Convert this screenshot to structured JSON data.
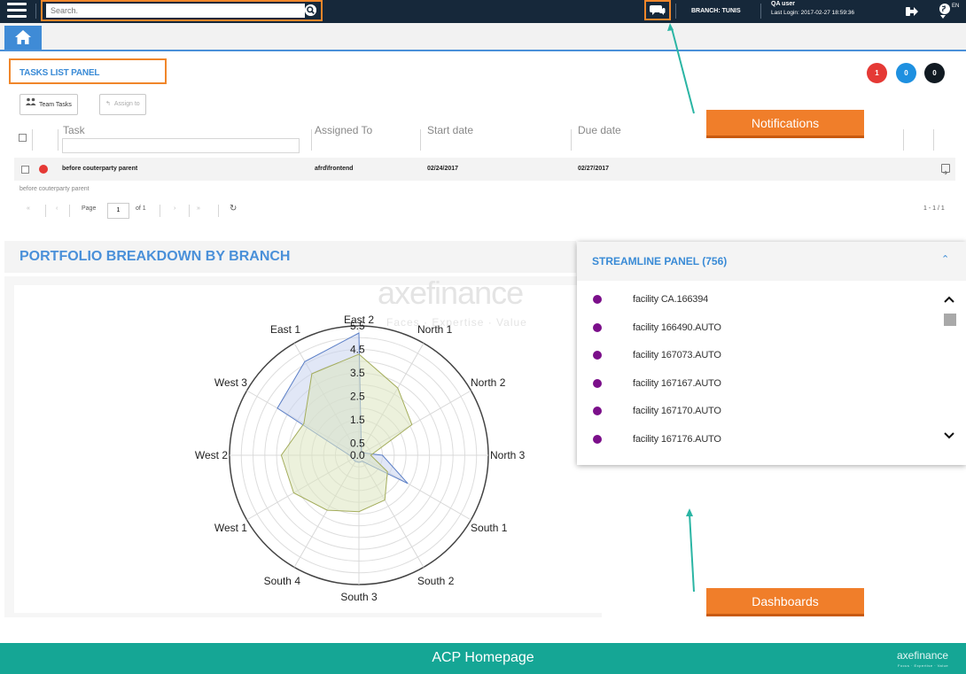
{
  "header": {
    "search_placeholder": "Search.",
    "branch": "BRANCH: TUNIS",
    "user_name": "QA user",
    "last_login": "Last Login: 2017-02-27 18:59:36",
    "language": "EN",
    "icons": [
      "menu-icon",
      "search-icon",
      "chat-icon",
      "logout-icon",
      "globe-icon"
    ]
  },
  "tabs": {
    "icons": [
      "home-icon"
    ]
  },
  "tasks_panel": {
    "title": "TASKS LIST PANEL",
    "badges": [
      {
        "value": "1",
        "color": "#e53935"
      },
      {
        "value": "0",
        "color": "#1e90e0"
      },
      {
        "value": "0",
        "color": "#111a22"
      }
    ],
    "team_tasks_label": "Team Tasks",
    "assign_to_label": "Assign to",
    "columns": [
      "Task",
      "Assigned To",
      "Start date",
      "Due date"
    ],
    "rows": [
      {
        "task": "before couterparty parent",
        "assigned_to": "afrd\\frontend",
        "start_date": "02/24/2017",
        "due_date": "02/27/2017",
        "preview": "before couterparty parent"
      }
    ],
    "pager": {
      "page_label": "Page",
      "page": "1",
      "of": "of 1",
      "summary": "1 - 1 / 1"
    }
  },
  "portfolio": {
    "title": "PORTFOLIO BREAKDOWN BY BRANCH",
    "watermark": "axefinance",
    "watermark_sub": "Faces · Expertise · Value"
  },
  "chart_data": {
    "type": "radar",
    "categories": [
      "East 2",
      "North 1",
      "North 2",
      "North 3",
      "South 1",
      "South 2",
      "South 3",
      "South 4",
      "West 1",
      "West 2",
      "West 3",
      "East 1"
    ],
    "tick_labels": [
      "0.0",
      "0.5",
      "1.5",
      "2.5",
      "3.5",
      "4.5",
      "5.5"
    ],
    "ylim": [
      0,
      5.5
    ],
    "series": [
      {
        "color": "#c8d3ef",
        "values": [
          5.2,
          0.2,
          0.2,
          1.0,
          2.4,
          0.3,
          0.3,
          0.3,
          0.3,
          0.4,
          4.0,
          4.6
        ]
      },
      {
        "color": "#dde6bf",
        "values": [
          4.3,
          3.3,
          2.6,
          0.5,
          1.4,
          2.2,
          2.4,
          2.7,
          3.2,
          3.3,
          2.7,
          4.0
        ]
      }
    ]
  },
  "streamline": {
    "title": "STREAMLINE PANEL (756)",
    "dot_color": "#7b0f8a",
    "items": [
      "facility CA.166394",
      "facility 166490.AUTO",
      "facility 167073.AUTO",
      "facility 167167.AUTO",
      "facility 167170.AUTO",
      "facility 167176.AUTO"
    ]
  },
  "callouts": {
    "notifications": "Notifications",
    "dashboards": "Dashboards"
  },
  "footer": {
    "title": "ACP Homepage",
    "logo": "axefinance",
    "logo_sub": "Focus · Expertise · Value"
  }
}
